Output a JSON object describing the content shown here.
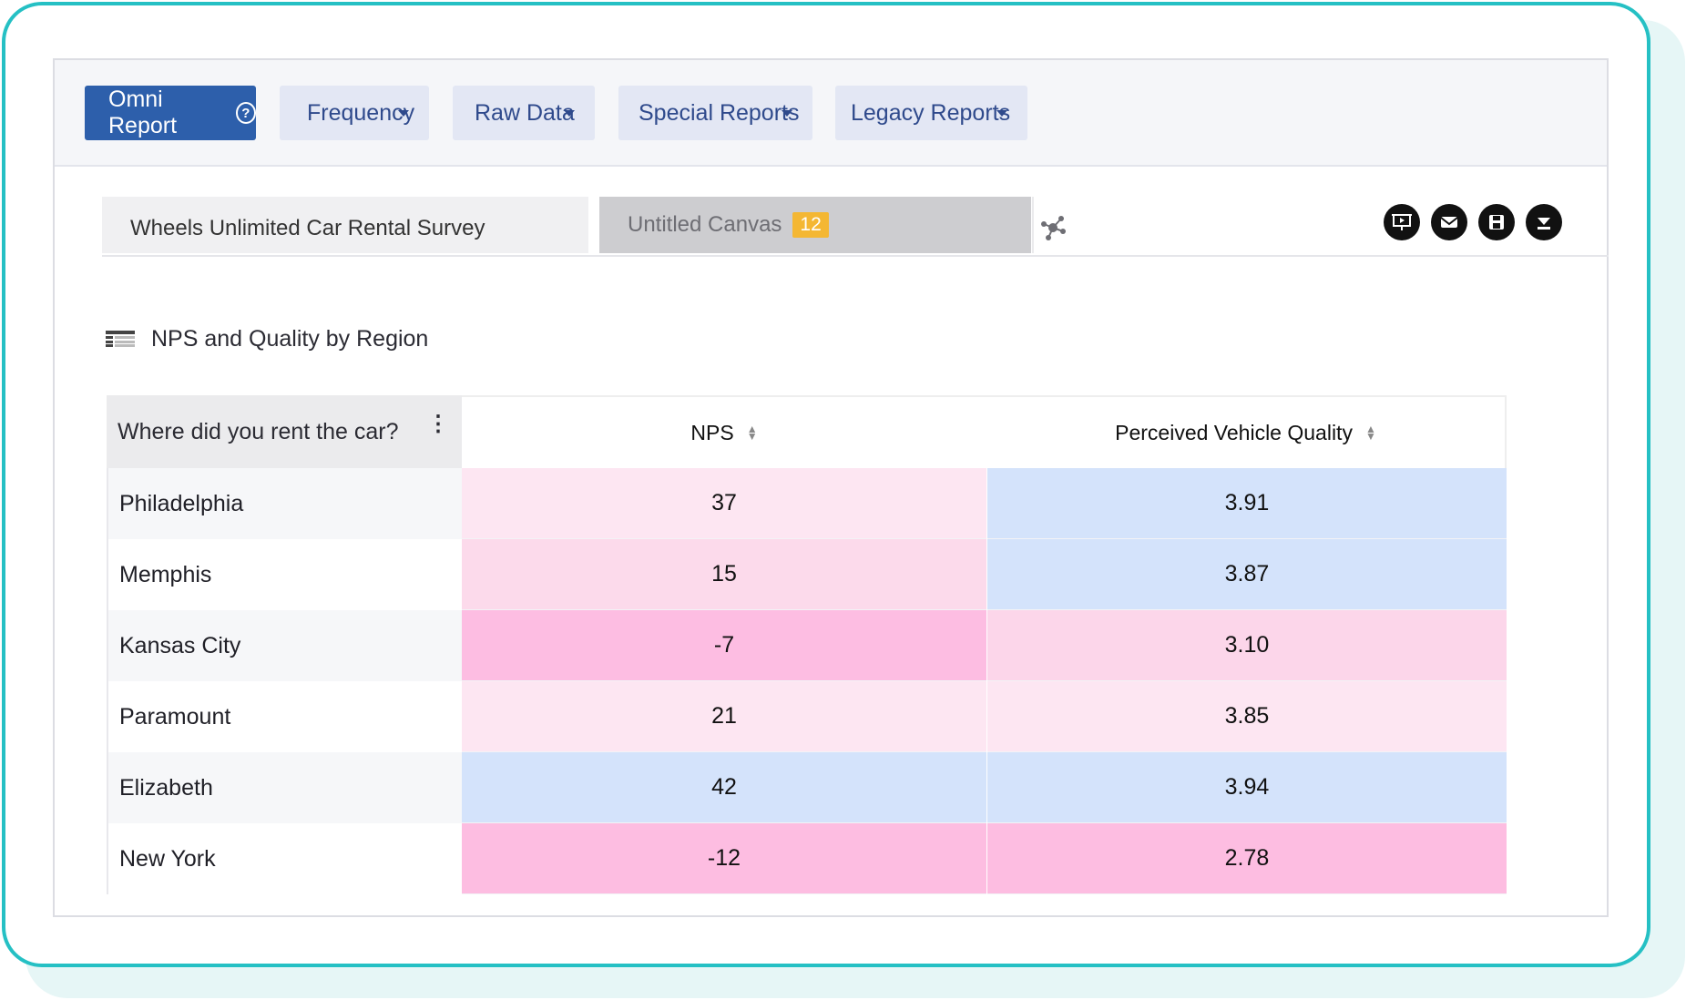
{
  "toolbar": {
    "omni_report": "Omni Report",
    "frequency": "Frequency",
    "raw_data": "Raw Data",
    "special_reports": "Special Reports",
    "legacy_reports": "Legacy Reports"
  },
  "tabs": {
    "survey": "Wheels Unlimited Car Rental Survey",
    "canvas": "Untitled Canvas",
    "canvas_badge": "12"
  },
  "actions": [
    "present-icon",
    "email-icon",
    "save-icon",
    "download-icon"
  ],
  "widget": {
    "title": "NPS and Quality by Region",
    "columns": {
      "row_header": "Where did you rent the car?",
      "nps": "NPS",
      "quality": "Perceived Vehicle Quality"
    },
    "rows": [
      {
        "city": "Philadelphia",
        "nps": "37",
        "quality": "3.91"
      },
      {
        "city": "Memphis",
        "nps": "15",
        "quality": "3.87"
      },
      {
        "city": "Kansas City",
        "nps": "-7",
        "quality": "3.10"
      },
      {
        "city": "Paramount",
        "nps": "21",
        "quality": "3.85"
      },
      {
        "city": "Elizabeth",
        "nps": "42",
        "quality": "3.94"
      },
      {
        "city": "New York",
        "nps": "-12",
        "quality": "2.78"
      }
    ]
  },
  "colors": {
    "accent": "#25c0c4",
    "primary_button": "#2d5fab",
    "heat_blue": "#d4e3fb",
    "heat_pink_light": "#fde6f2",
    "heat_pink_mid": "#fcd6ea",
    "heat_pink_strong": "#fdbde1",
    "badge": "#f4b733"
  }
}
